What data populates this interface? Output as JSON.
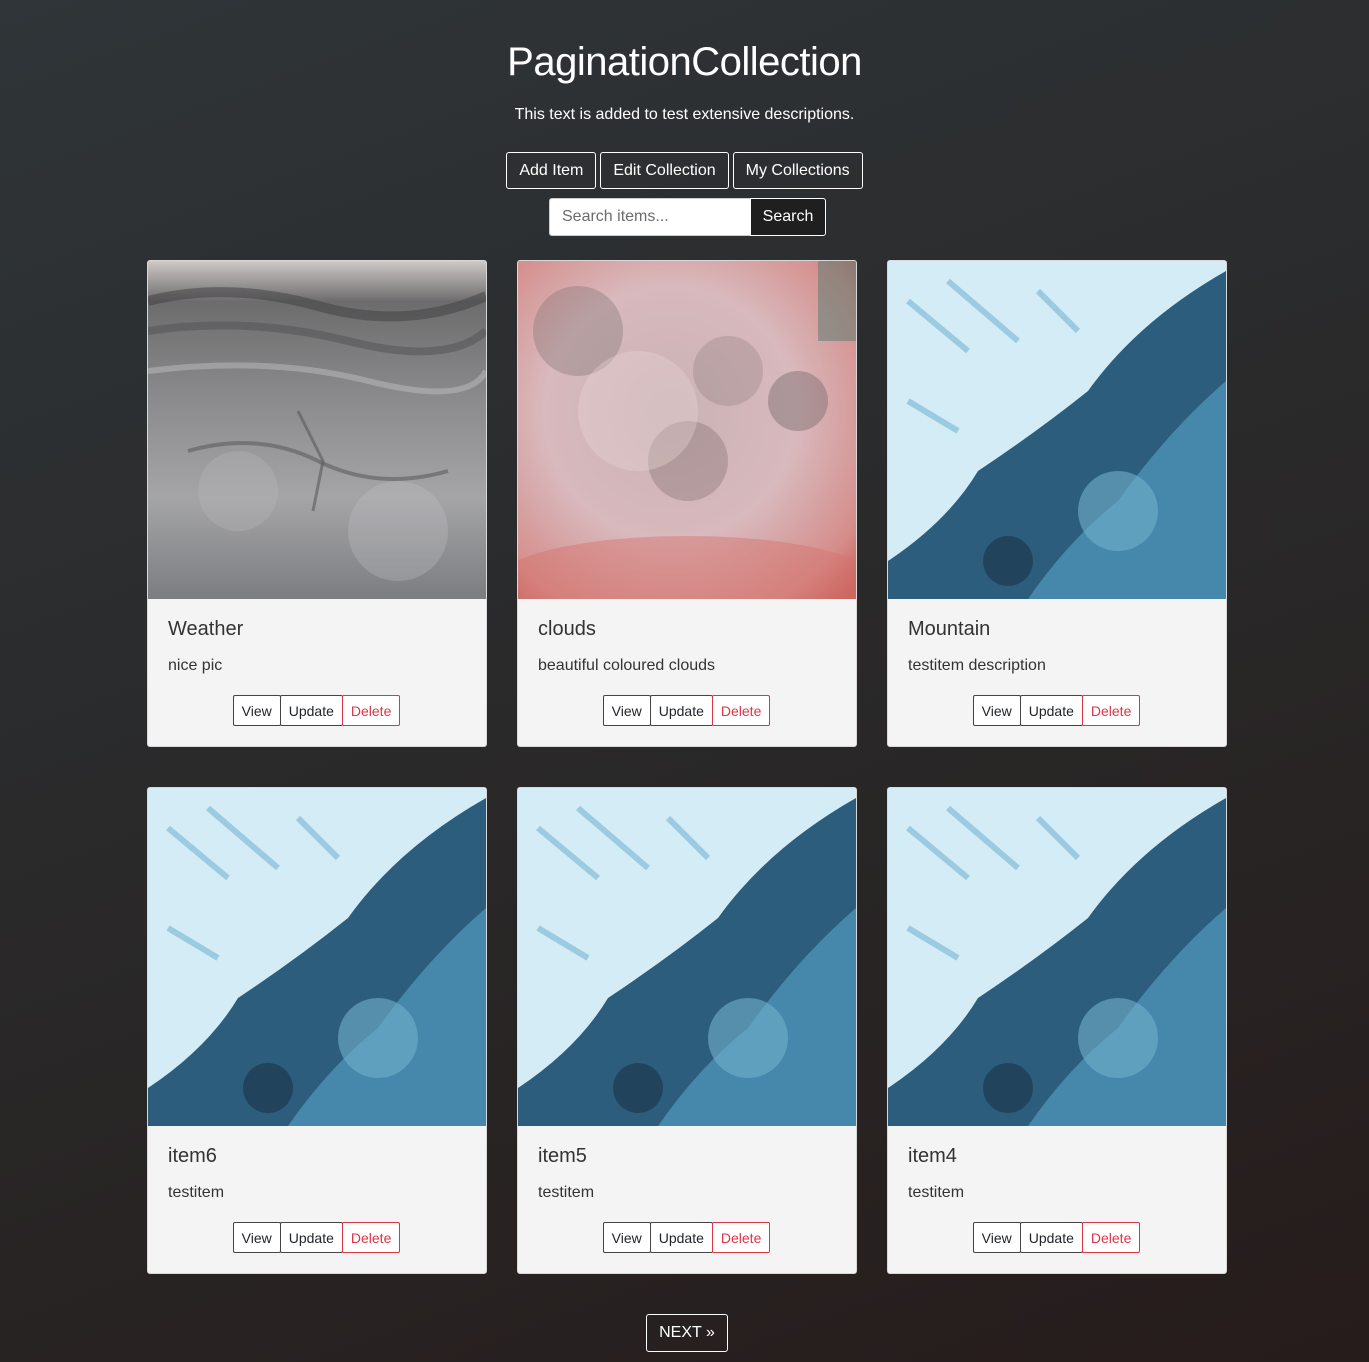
{
  "header": {
    "title": "PaginationCollection",
    "description": "This text is added to test extensive descriptions."
  },
  "actions": {
    "add_item": "Add Item",
    "edit_collection": "Edit Collection",
    "my_collections": "My Collections"
  },
  "search": {
    "placeholder": "Search items...",
    "value": "",
    "button_label": "Search"
  },
  "items": [
    {
      "title": "Weather",
      "description": "nice pic",
      "image": "frost-texture"
    },
    {
      "title": "clouds",
      "description": "beautiful coloured clouds",
      "image": "pink-clouds"
    },
    {
      "title": "Mountain",
      "description": "testitem description",
      "image": "glacier-aerial"
    },
    {
      "title": "item6",
      "description": "testitem",
      "image": "glacier-aerial"
    },
    {
      "title": "item5",
      "description": "testitem",
      "image": "glacier-aerial"
    },
    {
      "title": "item4",
      "description": "testitem",
      "image": "glacier-aerial"
    }
  ],
  "card_buttons": {
    "view": "View",
    "update": "Update",
    "delete": "Delete"
  },
  "pagination": {
    "next_label": "NEXT »"
  },
  "colors": {
    "background": "#2b2b2c",
    "card": "#f4f4f4",
    "delete": "#dc3545"
  }
}
